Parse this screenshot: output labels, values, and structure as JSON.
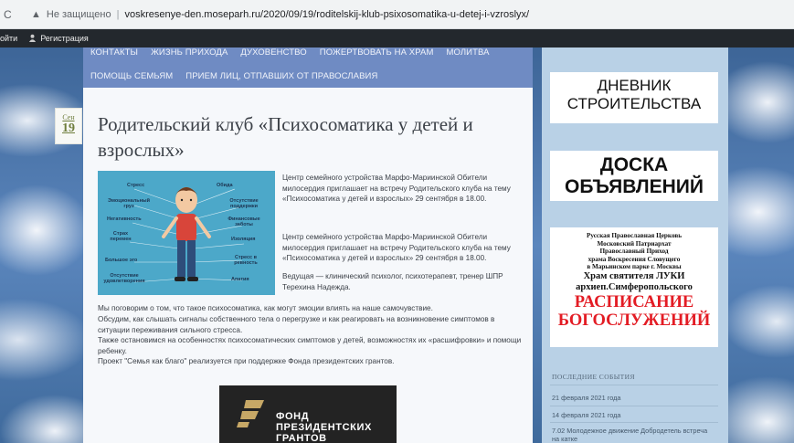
{
  "browser": {
    "warning": "▲",
    "security": "Не защищено",
    "separator": "|",
    "url": "voskresenye-den.moseparh.ru/2020/09/19/roditelskij-klub-psixosomatika-u-detej-i-vzroslyx/",
    "reload_icon": "reload-icon"
  },
  "admin_bar": {
    "login": "ойти",
    "register": "Регистрация"
  },
  "nav": {
    "row1": [
      "КОНТАКТЫ",
      "ЖИЗНЬ ПРИХОДА",
      "ДУХОВЕНСТВО",
      "ПОЖЕРТВОВАТЬ НА ХРАМ",
      "МОЛИТВА"
    ],
    "row2": [
      "ПОМОЩЬ СЕМЬЯМ",
      "ПРИЕМ ЛИЦ, ОТПАВШИХ ОТ ПРАВОСЛАВИЯ"
    ]
  },
  "post": {
    "date_month": "Сен",
    "date_day": "19",
    "title": "Родительский клуб «Психосоматика у детей и взрослых»",
    "p1": "Центр семейного устройства Марфо-Мариинской Обители милосердия приглашает на встречу Родительского клуба на тему «Психосоматика у детей и взрослых» 29 сентября в 18.00.",
    "p2": "Центр семейного устройства Марфо-Мариинской Обители милосердия приглашает на встречу Родительского клуба на тему «Психосоматика у детей и взрослых» 29 сентября в 18.00.",
    "p3": "Ведущая — клинический психолог, психотерапевт, тренер ШПР Терехина Надежда.",
    "p4": "Мы поговорим о том, что такое психосоматика, как могут эмоции влиять на наше самочувствие.",
    "p5": "Обсудим, как слышать сигналы собственного тела о перегрузке и как реагировать на возникновение симптомов в ситуации переживания сильного стресса.",
    "p6": "Также остановимся на особенностях психосоматических симптомов у детей, возможностях их «расшифровки» и помощи ребенку.",
    "p7": "Проект \"Семья как благо\" реализуется при поддержке Фонда президентских грантов.",
    "illustration_tags": {
      "stress": "Стресс",
      "offense": "Обида",
      "emotional_load": "Эмоциональный груз",
      "no_support": "Отсутствие поддержки",
      "negativity": "Негативность",
      "financial_worries": "Финансовые заботы",
      "fear_of_change": "Страх перемен",
      "isolation": "Изоляция",
      "big_ego": "Большое эго",
      "stress_in_relationships": "Стресс в ревность",
      "no_satisfaction": "Отсутствие удовлетворения",
      "apathy": "Апатия"
    },
    "fund_text": [
      "ФОНД",
      "ПРЕЗИДЕНТСКИХ",
      "ГРАНТОВ"
    ]
  },
  "sidebar": {
    "card1": [
      "ДНЕВНИК",
      "СТРОИТЕЛЬСТВА"
    ],
    "card2": [
      "ДОСКА",
      "ОБЪЯВЛЕНИЙ"
    ],
    "card3": {
      "lines": [
        "Русская Православная Церковь",
        "Московский Патриархат",
        "Православный Приход",
        "храма Воскресения Словущего",
        "в Марьинском парке г. Москвы"
      ],
      "big": [
        "Храм святителя ЛУКИ",
        "архиеп.Симферопольского"
      ],
      "red": [
        "РАСПИСАНИЕ",
        "БОГОСЛУЖЕНИЙ"
      ]
    },
    "events_heading": "ПОСЛЕДНИЕ СОБЫТИЯ",
    "events": [
      "21 февраля 2021 года",
      "14 февраля 2021 года",
      "7.02 Молодежное движение Добродетель встреча на катке"
    ]
  },
  "colors": {
    "nav": "#6f8bc3",
    "sidebar": "#b9d1e6",
    "date": "#6f7e3d",
    "schedule_red": "#e31c24",
    "page_sky": "#4a6fa0"
  }
}
